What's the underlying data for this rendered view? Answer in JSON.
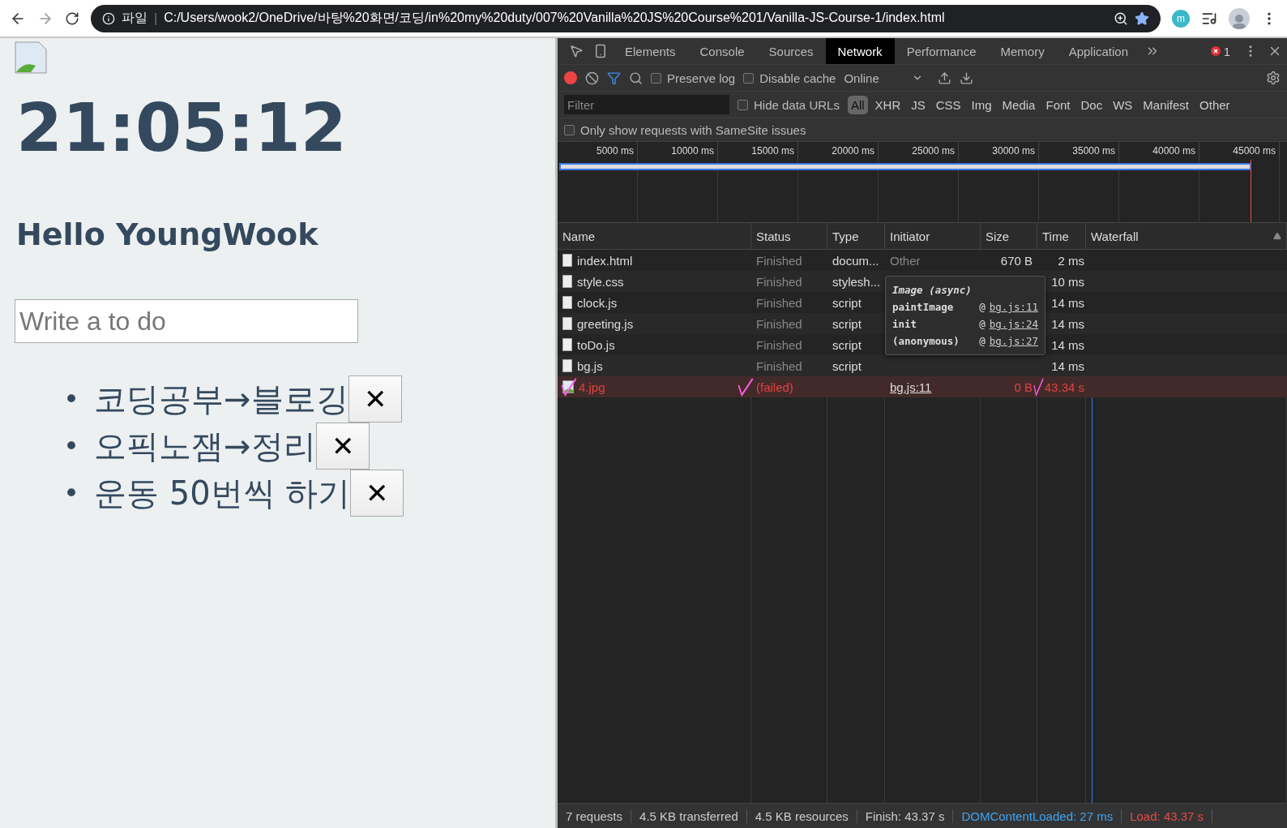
{
  "browser": {
    "scheme_label": "파일",
    "separator": "|",
    "url": "C:/Users/wook2/OneDrive/바탕%20화면/코딩/in%20my%20duty/007%20Vanilla%20JS%20Course%201/Vanilla-JS-Course-1/index.html",
    "extension_label": "m"
  },
  "page": {
    "clock": "21:05:12",
    "greeting": "Hello YoungWook",
    "todo_input": {
      "placeholder": "Write a to do"
    },
    "todos": [
      {
        "bullet": "•",
        "text": "코딩공부→블로깅",
        "delete_label": "✕"
      },
      {
        "bullet": "•",
        "text": "오픽노잼→정리",
        "delete_label": "✕"
      },
      {
        "bullet": "•",
        "text": "운동 50번씩 하기",
        "delete_label": "✕"
      }
    ]
  },
  "devtools": {
    "tabs": [
      {
        "label": "Elements",
        "selected": false
      },
      {
        "label": "Console",
        "selected": false
      },
      {
        "label": "Sources",
        "selected": false
      },
      {
        "label": "Network",
        "selected": true
      },
      {
        "label": "Performance",
        "selected": false
      },
      {
        "label": "Memory",
        "selected": false
      },
      {
        "label": "Application",
        "selected": false
      }
    ],
    "error_count": "1",
    "toolbar": {
      "recording": true,
      "preserve_log": {
        "label": "Preserve log",
        "checked": false
      },
      "disable_cache": {
        "label": "Disable cache",
        "checked": false
      },
      "throttling": "Online"
    },
    "filter": {
      "placeholder": "Filter",
      "hide_data_urls": {
        "label": "Hide data URLs",
        "checked": false
      },
      "types": [
        {
          "label": "All",
          "selected": true
        },
        {
          "label": "XHR",
          "selected": false
        },
        {
          "label": "JS",
          "selected": false
        },
        {
          "label": "CSS",
          "selected": false
        },
        {
          "label": "Img",
          "selected": false
        },
        {
          "label": "Media",
          "selected": false
        },
        {
          "label": "Font",
          "selected": false
        },
        {
          "label": "Doc",
          "selected": false
        },
        {
          "label": "WS",
          "selected": false
        },
        {
          "label": "Manifest",
          "selected": false
        },
        {
          "label": "Other",
          "selected": false
        }
      ]
    },
    "samesite": {
      "label": "Only show requests with SameSite issues",
      "checked": false
    },
    "timeline_ticks": [
      "5000 ms",
      "10000 ms",
      "15000 ms",
      "20000 ms",
      "25000 ms",
      "30000 ms",
      "35000 ms",
      "40000 ms",
      "45000 ms"
    ],
    "columns": [
      "Name",
      "Status",
      "Type",
      "Initiator",
      "Size",
      "Time",
      "Waterfall"
    ],
    "rows": [
      {
        "kind": "document",
        "name": "index.html",
        "status": "Finished",
        "type": "docum...",
        "initiator": "Other",
        "size": "670 B",
        "time": "2 ms",
        "failed": false
      },
      {
        "kind": "document",
        "name": "style.css",
        "status": "Finished",
        "type": "stylesh...",
        "time": "10 ms",
        "failed": false
      },
      {
        "kind": "document",
        "name": "clock.js",
        "status": "Finished",
        "type": "script",
        "time": "14 ms",
        "failed": false
      },
      {
        "kind": "document",
        "name": "greeting.js",
        "status": "Finished",
        "type": "script",
        "time": "14 ms",
        "failed": false
      },
      {
        "kind": "document",
        "name": "toDo.js",
        "status": "Finished",
        "type": "script",
        "time": "14 ms",
        "failed": false
      },
      {
        "kind": "document",
        "name": "bg.js",
        "status": "Finished",
        "type": "script",
        "time": "14 ms",
        "failed": false
      },
      {
        "kind": "image",
        "name": "4.jpg",
        "status": "(failed)",
        "initiator": "bg.js:11",
        "size": "0 B",
        "time": "43.34 s",
        "failed": true
      }
    ],
    "tooltip": {
      "title": "Image (async)",
      "frames": [
        {
          "function": "paintImage",
          "at": "@",
          "location": "bg.js:11"
        },
        {
          "function": "init",
          "at": "@",
          "location": "bg.js:24"
        },
        {
          "function": "(anonymous)",
          "at": "@",
          "location": "bg.js:27"
        }
      ]
    },
    "status_bar": [
      {
        "text": "7 requests",
        "kind": "plain"
      },
      {
        "text": "4.5 KB transferred",
        "kind": "plain"
      },
      {
        "text": "4.5 KB resources",
        "kind": "plain"
      },
      {
        "text": "Finish: 43.37 s",
        "kind": "plain"
      },
      {
        "text": "DOMContentLoaded: 27 ms",
        "kind": "dcl"
      },
      {
        "text": "Load: 43.37 s",
        "kind": "load"
      }
    ]
  }
}
